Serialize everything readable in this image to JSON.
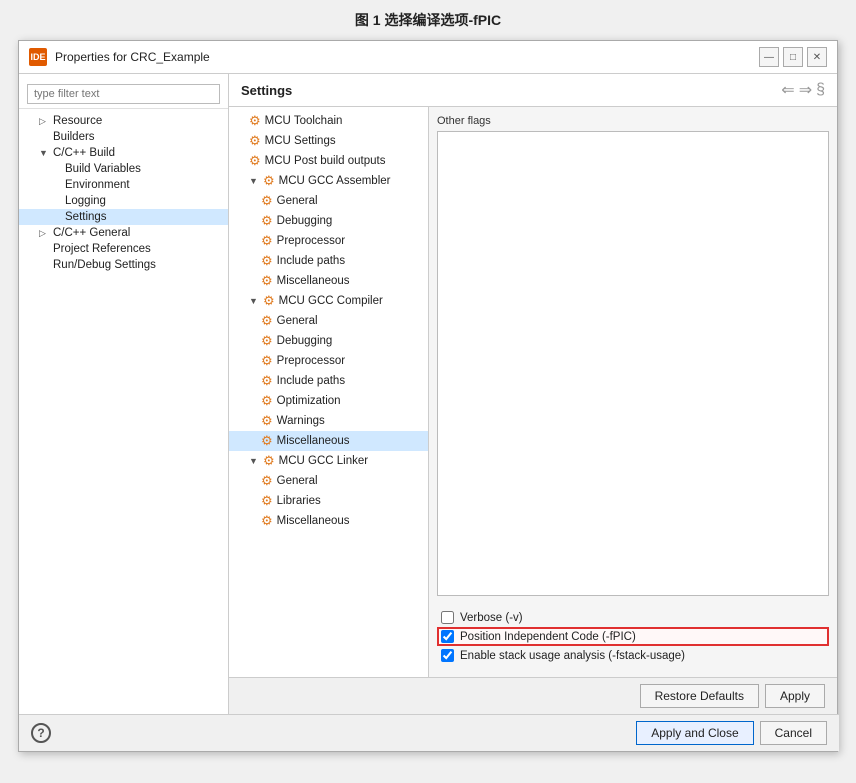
{
  "page": {
    "title": "图 1 选择编译选项-fPIC"
  },
  "window": {
    "title": "Properties for CRC_Example",
    "ide_label": "IDE"
  },
  "title_controls": {
    "minimize": "—",
    "maximize": "□",
    "close": "✕"
  },
  "filter": {
    "placeholder": "type filter text"
  },
  "settings_label": "Settings",
  "header_nav": "⇐ ⇒ §",
  "tree": {
    "items": [
      {
        "id": "resource",
        "label": "Resource",
        "level": 1,
        "expand": "▷",
        "icon": false
      },
      {
        "id": "builders",
        "label": "Builders",
        "level": 1,
        "expand": "",
        "icon": false
      },
      {
        "id": "cpp-build",
        "label": "C/C++ Build",
        "level": 1,
        "expand": "▼",
        "icon": false
      },
      {
        "id": "build-variables",
        "label": "Build Variables",
        "level": 2,
        "expand": "",
        "icon": false
      },
      {
        "id": "environment",
        "label": "Environment",
        "level": 2,
        "expand": "",
        "icon": false
      },
      {
        "id": "logging",
        "label": "Logging",
        "level": 2,
        "expand": "",
        "icon": false
      },
      {
        "id": "settings",
        "label": "Settings",
        "level": 2,
        "expand": "",
        "icon": false,
        "selected": true
      },
      {
        "id": "cpp-general",
        "label": "C/C++ General",
        "level": 1,
        "expand": "▷",
        "icon": false
      },
      {
        "id": "project-references",
        "label": "Project References",
        "level": 1,
        "expand": "",
        "icon": false
      },
      {
        "id": "run-debug-settings",
        "label": "Run/Debug Settings",
        "level": 1,
        "expand": "",
        "icon": false
      }
    ]
  },
  "right_tree": {
    "items": [
      {
        "id": "mcu-toolchain",
        "label": "MCU Toolchain",
        "level": 1,
        "expand": ""
      },
      {
        "id": "mcu-settings",
        "label": "MCU Settings",
        "level": 1,
        "expand": ""
      },
      {
        "id": "mcu-post-build",
        "label": "MCU Post build outputs",
        "level": 1,
        "expand": ""
      },
      {
        "id": "mcu-gcc-assembler",
        "label": "MCU GCC Assembler",
        "level": 1,
        "expand": "▼"
      },
      {
        "id": "assembler-general",
        "label": "General",
        "level": 2,
        "expand": ""
      },
      {
        "id": "assembler-debugging",
        "label": "Debugging",
        "level": 2,
        "expand": ""
      },
      {
        "id": "assembler-preprocessor",
        "label": "Preprocessor",
        "level": 2,
        "expand": ""
      },
      {
        "id": "assembler-include-paths",
        "label": "Include paths",
        "level": 2,
        "expand": ""
      },
      {
        "id": "assembler-misc",
        "label": "Miscellaneous",
        "level": 2,
        "expand": ""
      },
      {
        "id": "mcu-gcc-compiler",
        "label": "MCU GCC Compiler",
        "level": 1,
        "expand": "▼"
      },
      {
        "id": "compiler-general",
        "label": "General",
        "level": 2,
        "expand": ""
      },
      {
        "id": "compiler-debugging",
        "label": "Debugging",
        "level": 2,
        "expand": ""
      },
      {
        "id": "compiler-preprocessor",
        "label": "Preprocessor",
        "level": 2,
        "expand": ""
      },
      {
        "id": "compiler-include-paths",
        "label": "Include paths",
        "level": 2,
        "expand": ""
      },
      {
        "id": "compiler-optimization",
        "label": "Optimization",
        "level": 2,
        "expand": ""
      },
      {
        "id": "compiler-warnings",
        "label": "Warnings",
        "level": 2,
        "expand": ""
      },
      {
        "id": "compiler-misc",
        "label": "Miscellaneous",
        "level": 2,
        "expand": "",
        "selected": true
      },
      {
        "id": "mcu-gcc-linker",
        "label": "MCU GCC Linker",
        "level": 1,
        "expand": "▼"
      },
      {
        "id": "linker-general",
        "label": "General",
        "level": 2,
        "expand": ""
      },
      {
        "id": "linker-libraries",
        "label": "Libraries",
        "level": 2,
        "expand": ""
      },
      {
        "id": "linker-misc",
        "label": "Miscellaneous",
        "level": 2,
        "expand": ""
      }
    ]
  },
  "other_flags": {
    "label": "Other flags"
  },
  "checkboxes": [
    {
      "id": "verbose",
      "label": "Verbose (-v)",
      "checked": false,
      "highlighted": false
    },
    {
      "id": "position-independent",
      "label": "Position Independent Code (-fPIC)",
      "checked": true,
      "highlighted": true
    },
    {
      "id": "stack-usage",
      "label": "Enable stack usage analysis (-fstack-usage)",
      "checked": true,
      "highlighted": false
    }
  ],
  "buttons": {
    "restore_defaults": "Restore Defaults",
    "apply": "Apply"
  },
  "footer": {
    "apply_close": "Apply and Close",
    "cancel": "Cancel"
  }
}
